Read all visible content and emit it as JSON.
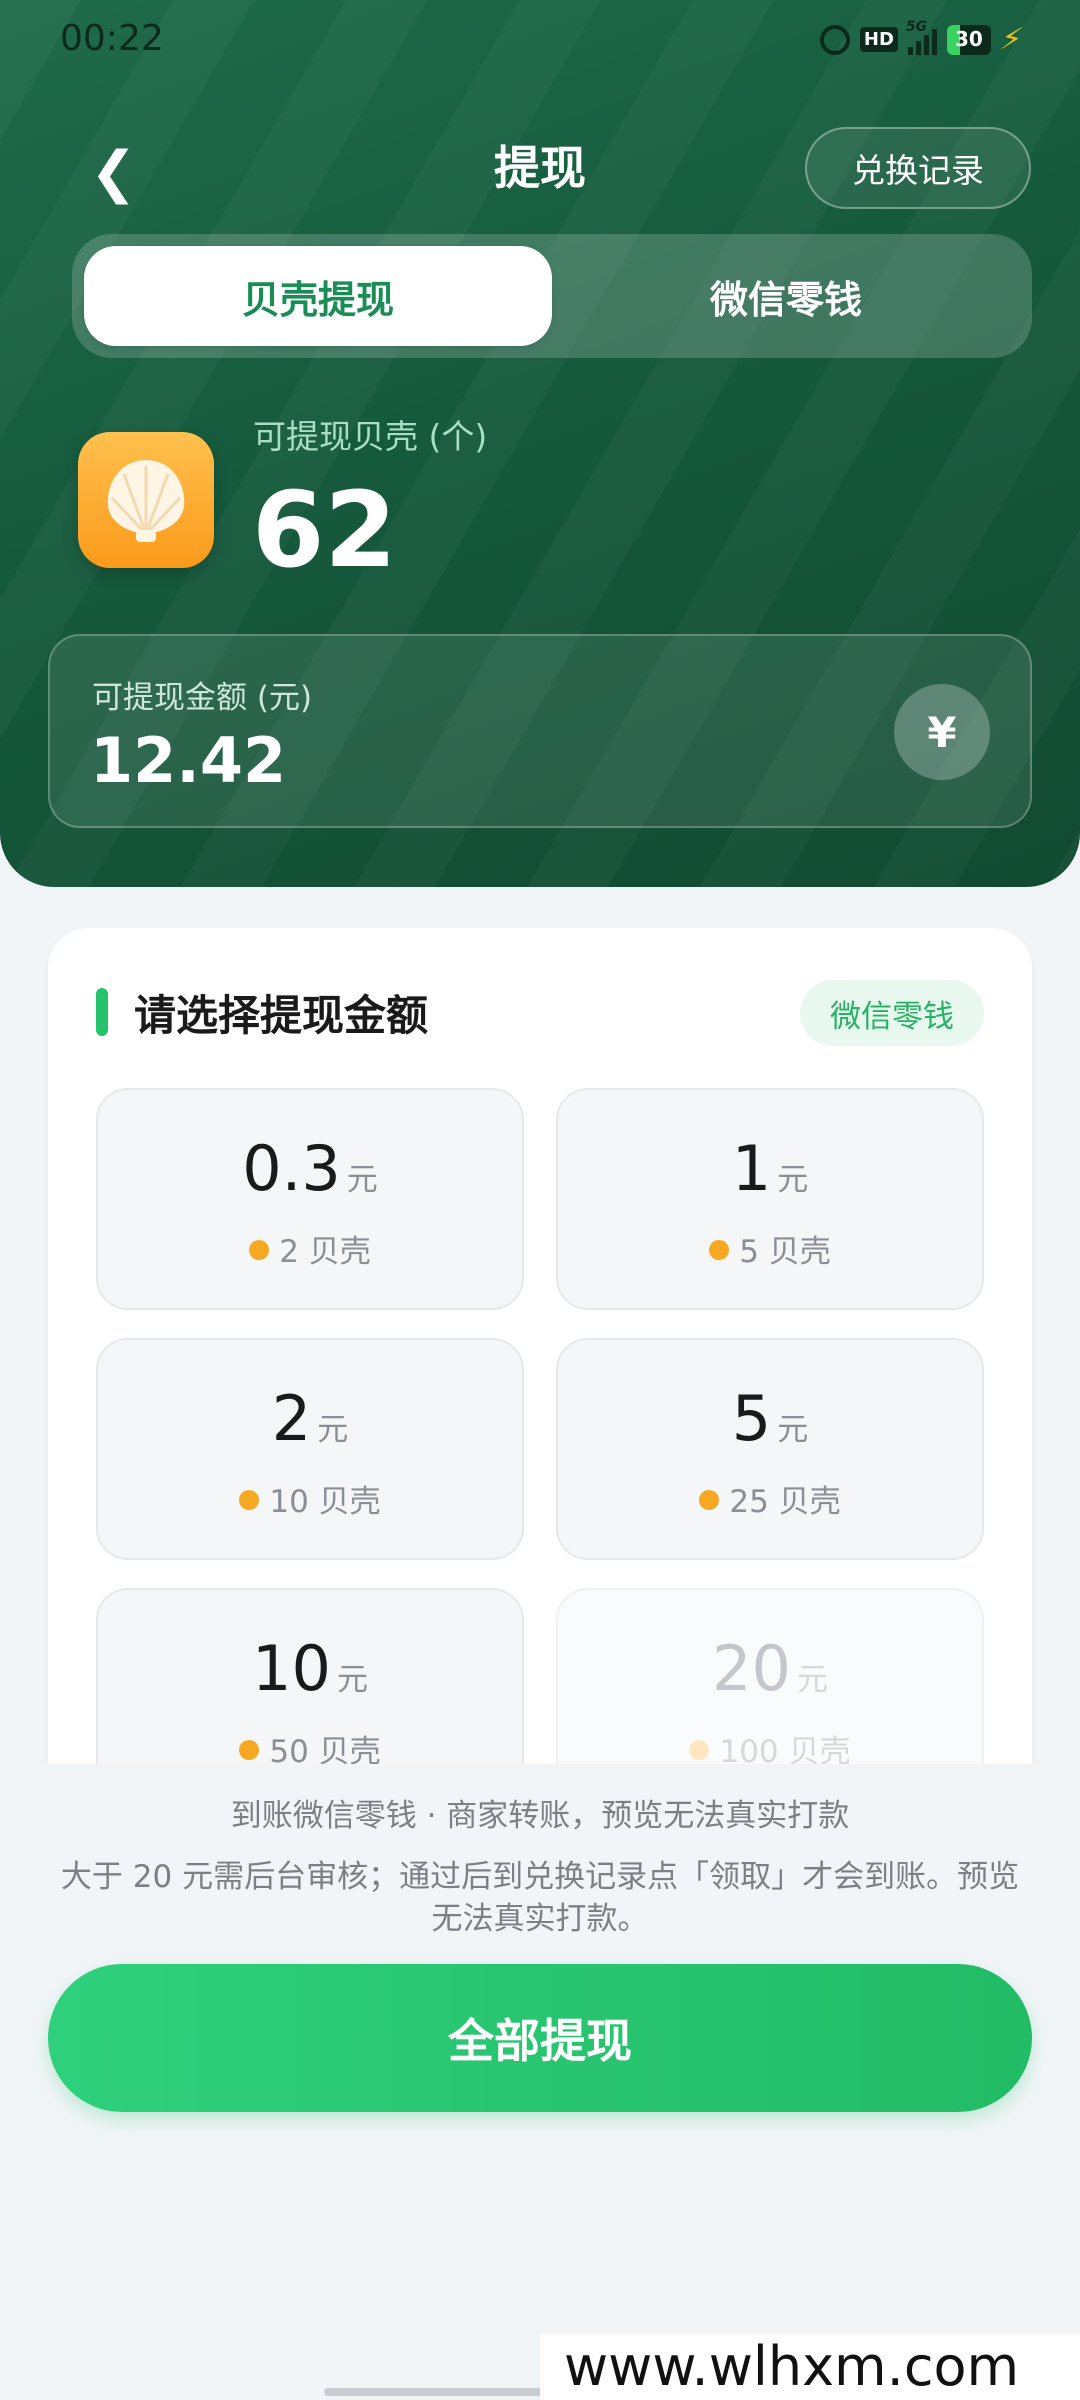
{
  "status_bar": {
    "time": "00:22",
    "hd": "HD",
    "network": "5G",
    "battery": "30"
  },
  "header": {
    "back_icon": "chevron-left-icon",
    "title": "提现",
    "record_label": "兑换记录",
    "tabs": [
      {
        "label": "贝壳提现",
        "active": true
      },
      {
        "label": "微信零钱",
        "active": false
      }
    ],
    "shell_label": "可提现贝壳 (个)",
    "shell_count": "62",
    "amount_label": "可提现金额 (元)",
    "amount_value": "12.42",
    "currency_symbol": "¥"
  },
  "selection": {
    "title": "请选择提现金额",
    "channel_badge": "微信零钱",
    "options": [
      {
        "amount": "0.3",
        "unit": "元",
        "cost": "2 贝壳",
        "enabled": true
      },
      {
        "amount": "1",
        "unit": "元",
        "cost": "5 贝壳",
        "enabled": true
      },
      {
        "amount": "2",
        "unit": "元",
        "cost": "10 贝壳",
        "enabled": true
      },
      {
        "amount": "5",
        "unit": "元",
        "cost": "25 贝壳",
        "enabled": true
      },
      {
        "amount": "10",
        "unit": "元",
        "cost": "50 贝壳",
        "enabled": true
      },
      {
        "amount": "20",
        "unit": "元",
        "cost": "100 贝壳",
        "enabled": false
      }
    ]
  },
  "footer": {
    "note1": "到账微信零钱 · 商家转账，预览无法真实打款",
    "note2": "大于 20 元需后台审核；通过后到兑换记录点「领取」才会到账。预览无法真实打款。",
    "withdraw_label": "全部提现"
  },
  "watermark": "www.wlhxm.com",
  "colors": {
    "primary_green": "#27c26c",
    "header_green": "#165a3d",
    "coin_orange": "#f6a823"
  }
}
